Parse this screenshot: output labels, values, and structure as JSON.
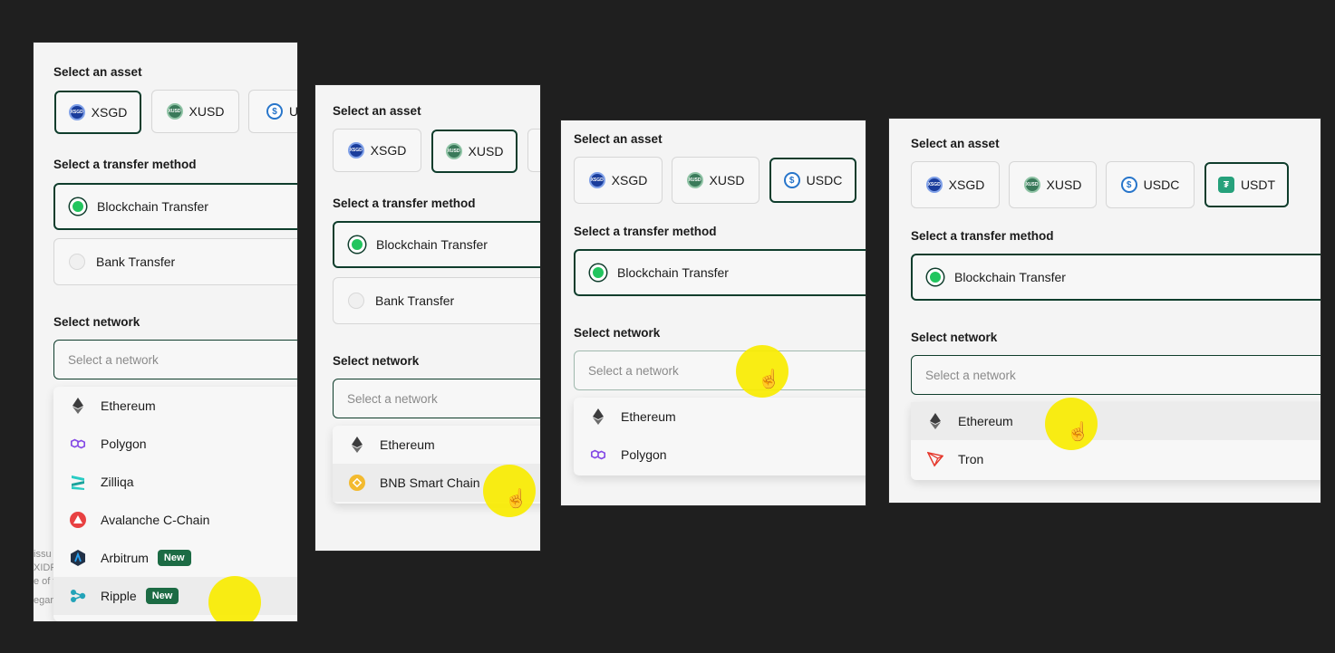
{
  "labels": {
    "asset": "Select an asset",
    "method": "Select a transfer method",
    "network": "Select network",
    "network_placeholder": "Select a network",
    "new_badge": "New"
  },
  "assets": {
    "xsgd": "XSGD",
    "xusd": "XUSD",
    "usdc": "USDC",
    "usdt": "USDT",
    "usdc_truncated": "U"
  },
  "methods": {
    "blockchain": "Blockchain Transfer",
    "bank": "Bank Transfer"
  },
  "networks": {
    "ethereum": "Ethereum",
    "polygon": "Polygon",
    "zilliqa": "Zilliqa",
    "avalanche": "Avalanche C-Chain",
    "arbitrum": "Arbitrum",
    "ripple": "Ripple",
    "bnb": "BNB Smart Chain",
    "tron": "Tron"
  },
  "footer_fragments": [
    "issu",
    "XIDR",
    "e of t",
    "egar"
  ],
  "colors": {
    "background": "#1f1f1f",
    "panel": "#f4f4f4",
    "selected_border": "#0f3d2c",
    "radio_on": "#22c55e",
    "badge": "#1c6b44",
    "cursor_halo": "#f8ec00"
  }
}
